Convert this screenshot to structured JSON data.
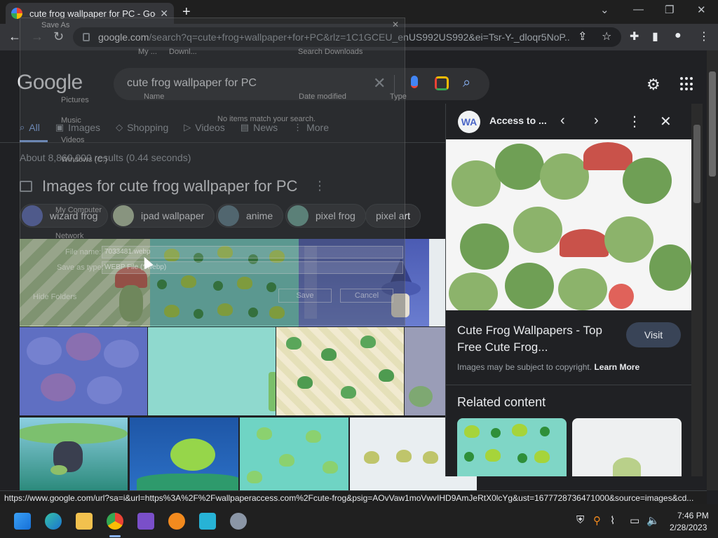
{
  "browser": {
    "tab_title": "cute frog wallpaper for PC - Goo",
    "tab_close": "✕",
    "new_tab": "+",
    "url_host": "google.com",
    "url_path": "/search?q=cute+frog+wallpaper+for+PC&rlz=1C1GCEU_enUS992US992&ei=Tsr-Y-_dloqr5NoP...",
    "status_url": "https://www.google.com/url?sa=i&url=https%3A%2F%2Fwallpaperaccess.com%2Fcute-frog&psig=AOvVaw1moVwvIHD9AmJeRtX0lcYg&ust=1677728736471000&source=images&cd..."
  },
  "google": {
    "logo": "Google",
    "query": "cute frog wallpaper for PC",
    "tabs": [
      {
        "label": "All",
        "icon": "⌕"
      },
      {
        "label": "Images",
        "icon": "▣"
      },
      {
        "label": "Shopping",
        "icon": "◇"
      },
      {
        "label": "Videos",
        "icon": "▷"
      },
      {
        "label": "News",
        "icon": "▤"
      },
      {
        "label": "More",
        "icon": "⋮"
      }
    ],
    "stats": "About 8,860,000 results (0.44 seconds)",
    "images_header": "Images for cute frog wallpaper for PC",
    "chips": [
      "wizard frog",
      "ipad wallpaper",
      "anime",
      "pixel frog",
      "pixel art"
    ]
  },
  "panel": {
    "source": "Access to ...",
    "title": "Cute Frog Wallpapers - Top Free Cute Frog...",
    "visit": "Visit",
    "copyright": "Images may be subject to copyright.",
    "learn_more": "Learn More",
    "related": "Related content",
    "source_icon_text": "WA"
  },
  "saveas": {
    "title": "Save As",
    "path_1": "My ...",
    "path_2": "Downl...",
    "search_placeholder": "Search Downloads",
    "col_name": "Name",
    "col_date": "Date modified",
    "col_type": "Type",
    "empty": "No items match your search.",
    "sidebar": [
      "Pictures",
      "Music",
      "Videos",
      "Windows (C:)",
      "My Computer",
      "Network"
    ],
    "file_name_label": "File name:",
    "file_name_value": "7033481.webp",
    "save_type_label": "Save as type:",
    "save_type_value": "WEBP File (*.webp)",
    "hide_folders": "Hide Folders",
    "save": "Save",
    "cancel": "Cancel"
  },
  "taskbar": {
    "time": "7:46 PM",
    "date": "2/28/2023"
  },
  "colors": {
    "accent": "#8ab4f8",
    "bg": "#202124",
    "frog_green": "#a6d43a",
    "teal": "#7fd6c6"
  }
}
